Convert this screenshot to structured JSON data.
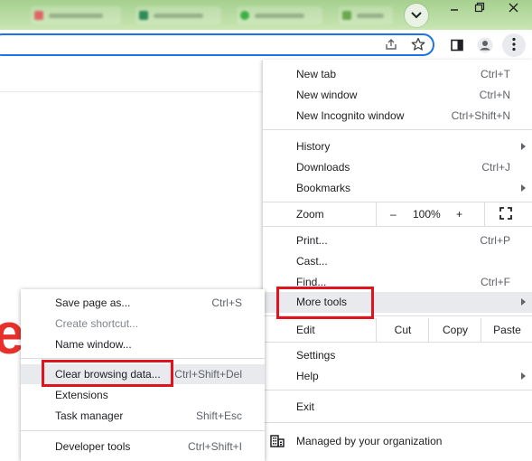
{
  "window_controls": {
    "minimize_icon": "minimize-icon",
    "restore_icon": "restore-icon",
    "close_icon": "close-icon"
  },
  "toolbar": {
    "share_icon": "share-icon",
    "bookmark_icon": "star-icon",
    "side_panel_icon": "side-panel-icon",
    "profile_icon": "profile-icon",
    "menu_icon": "kebab-menu-icon"
  },
  "page": {
    "logo_letter": "e"
  },
  "menu": {
    "new_tab": {
      "label": "New tab",
      "shortcut": "Ctrl+T"
    },
    "new_window": {
      "label": "New window",
      "shortcut": "Ctrl+N"
    },
    "new_incognito": {
      "label": "New Incognito window",
      "shortcut": "Ctrl+Shift+N"
    },
    "history": {
      "label": "History"
    },
    "downloads": {
      "label": "Downloads",
      "shortcut": "Ctrl+J"
    },
    "bookmarks": {
      "label": "Bookmarks"
    },
    "zoom": {
      "label": "Zoom",
      "minus": "–",
      "value": "100%",
      "plus": "+"
    },
    "print": {
      "label": "Print...",
      "shortcut": "Ctrl+P"
    },
    "cast": {
      "label": "Cast..."
    },
    "find": {
      "label": "Find...",
      "shortcut": "Ctrl+F"
    },
    "more_tools": {
      "label": "More tools"
    },
    "edit": {
      "label": "Edit",
      "cut": "Cut",
      "copy": "Copy",
      "paste": "Paste"
    },
    "settings": {
      "label": "Settings"
    },
    "help": {
      "label": "Help"
    },
    "exit": {
      "label": "Exit"
    },
    "managed": {
      "label": "Managed by your organization"
    }
  },
  "submenu": {
    "save_page": {
      "label": "Save page as...",
      "shortcut": "Ctrl+S"
    },
    "create_shortcut": {
      "label": "Create shortcut..."
    },
    "name_window": {
      "label": "Name window..."
    },
    "clear_browsing": {
      "label": "Clear browsing data...",
      "shortcut": "Ctrl+Shift+Del"
    },
    "extensions": {
      "label": "Extensions"
    },
    "task_manager": {
      "label": "Task manager",
      "shortcut": "Shift+Esc"
    },
    "developer_tools": {
      "label": "Developer tools",
      "shortcut": "Ctrl+Shift+I"
    }
  },
  "colors": {
    "highlight_box": "#e0141e",
    "tabstrip": "#a6d08f",
    "omnibox_focus": "#1a73e8",
    "logo": "#e8312a"
  }
}
